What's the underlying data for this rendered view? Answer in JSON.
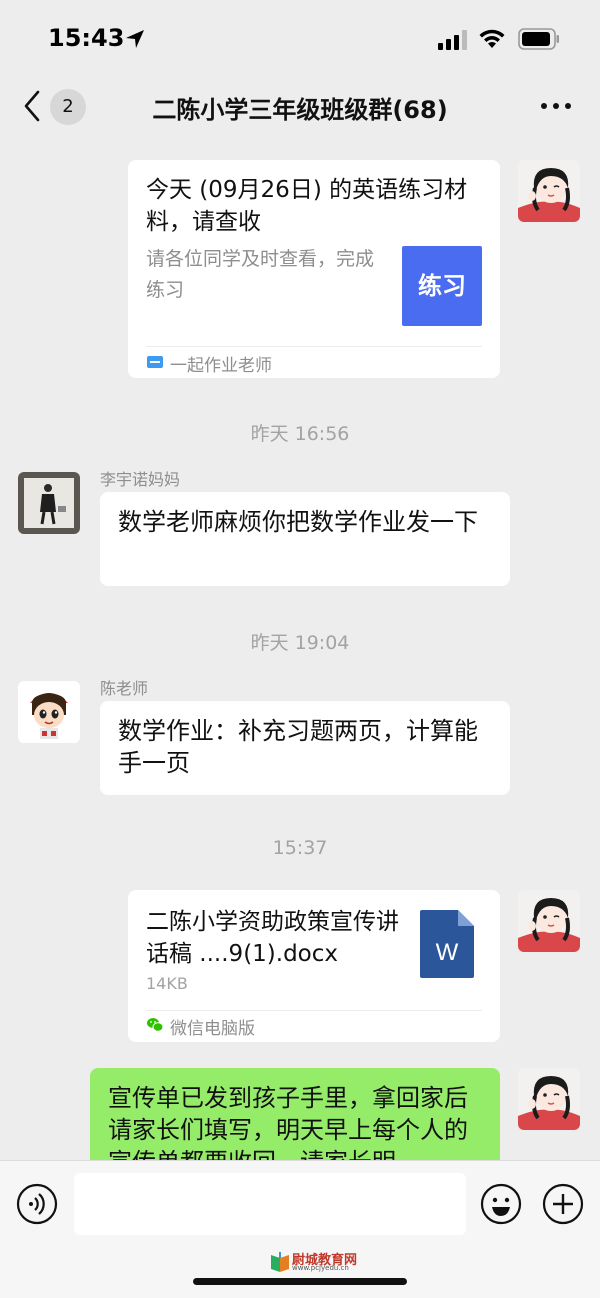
{
  "status_bar": {
    "time": "15:43"
  },
  "nav": {
    "unread_count": "2",
    "title": "二陈小学三年级班级群(68)"
  },
  "messages": [
    {
      "kind": "link-card",
      "title": "今天 (09月26日) 的英语练习材料，请查收",
      "description": "请各位同学及时查看，完成练习",
      "thumb_text": "练习",
      "thumb_color": "#4a6cf0",
      "source": "一起作业老师"
    },
    {
      "kind": "timestamp",
      "text": "昨天 16:56"
    },
    {
      "kind": "text",
      "sender": "李宇诺妈妈",
      "text": "数学老师麻烦你把数学作业发一下"
    },
    {
      "kind": "timestamp",
      "text": "昨天 19:04"
    },
    {
      "kind": "text",
      "sender": "陈老师",
      "text": "数学作业：补充习题两页，计算能手一页"
    },
    {
      "kind": "timestamp",
      "text": "15:37"
    },
    {
      "kind": "file-card",
      "filename": "二陈小学资助政策宣传讲话稿 ....9(1).docx",
      "size": "14KB",
      "file_badge": "W",
      "source": "微信电脑版"
    },
    {
      "kind": "text-self",
      "text": "宣传单已发到孩子手里，拿回家后请家长们填写，明天早上每个人的宣传单都要收回，请家长明"
    }
  ],
  "input_bar": {
    "watermark": "尉城教育网",
    "watermark_url": "www.pcjyedu.cn"
  },
  "colors": {
    "background": "#ededed",
    "self_bubble": "#95ec69",
    "other_bubble": "#ffffff",
    "word_blue": "#2b579a"
  }
}
